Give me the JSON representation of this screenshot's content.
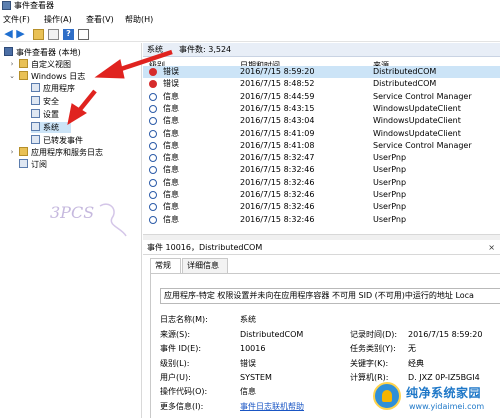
{
  "window": {
    "title": "事件查看器"
  },
  "menu": [
    "文件(F)",
    "操作(A)",
    "查看(V)",
    "帮助(H)"
  ],
  "tree": {
    "root": "事件查看器 (本地)",
    "items": [
      {
        "label": "自定义视图",
        "expander": "›"
      },
      {
        "label": "Windows 日志",
        "expander": "⌄"
      },
      {
        "label": "应用程序"
      },
      {
        "label": "安全"
      },
      {
        "label": "设置"
      },
      {
        "label": "系统"
      },
      {
        "label": "已转发事件"
      },
      {
        "label": "应用程序和服务日志",
        "expander": "›"
      },
      {
        "label": "订阅"
      }
    ]
  },
  "list": {
    "header": "系统",
    "count_text": "事件数: 3,524",
    "columns": [
      "级别",
      "日期和时间",
      "来源"
    ],
    "rows": [
      {
        "level": "错误",
        "type": "err",
        "datetime": "2016/7/15 8:59:20",
        "source": "DistributedCOM"
      },
      {
        "level": "错误",
        "type": "err",
        "datetime": "2016/7/15 8:48:52",
        "source": "DistributedCOM"
      },
      {
        "level": "信息",
        "type": "info",
        "datetime": "2016/7/15 8:44:59",
        "source": "Service Control Manager"
      },
      {
        "level": "信息",
        "type": "info",
        "datetime": "2016/7/15 8:43:15",
        "source": "WindowsUpdateClient"
      },
      {
        "level": "信息",
        "type": "info",
        "datetime": "2016/7/15 8:43:04",
        "source": "WindowsUpdateClient"
      },
      {
        "level": "信息",
        "type": "info",
        "datetime": "2016/7/15 8:41:09",
        "source": "WindowsUpdateClient"
      },
      {
        "level": "信息",
        "type": "info",
        "datetime": "2016/7/15 8:41:08",
        "source": "Service Control Manager"
      },
      {
        "level": "信息",
        "type": "info",
        "datetime": "2016/7/15 8:32:47",
        "source": "UserPnp"
      },
      {
        "level": "信息",
        "type": "info",
        "datetime": "2016/7/15 8:32:46",
        "source": "UserPnp"
      },
      {
        "level": "信息",
        "type": "info",
        "datetime": "2016/7/15 8:32:46",
        "source": "UserPnp"
      },
      {
        "level": "信息",
        "type": "info",
        "datetime": "2016/7/15 8:32:46",
        "source": "UserPnp"
      },
      {
        "level": "信息",
        "type": "info",
        "datetime": "2016/7/15 8:32:46",
        "source": "UserPnp"
      },
      {
        "level": "信息",
        "type": "info",
        "datetime": "2016/7/15 8:32:46",
        "source": "UserPnp"
      }
    ]
  },
  "detail": {
    "header": "事件 10016，DistributedCOM",
    "close": "×",
    "tabs": [
      "常规",
      "详细信息"
    ],
    "description": "应用程序-特定 权限设置并未向在应用程序容器 不可用 SID (不可用)中运行的地址 Loca",
    "fields": [
      {
        "k": "日志名称(M):",
        "v": "系统"
      },
      {
        "k": "来源(S):",
        "v": "DistributedCOM"
      },
      {
        "k": "事件 ID(E):",
        "v": "10016"
      },
      {
        "k": "级别(L):",
        "v": "错误"
      },
      {
        "k": "用户(U):",
        "v": "SYSTEM"
      },
      {
        "k": "操作代码(O):",
        "v": "信息"
      },
      {
        "k": "更多信息(I):",
        "v": "事件日志联机帮助"
      }
    ],
    "fields_right": [
      {
        "k": "记录时间(D):",
        "v": "2016/7/15 8:59:20"
      },
      {
        "k": "任务类别(Y):",
        "v": "无"
      },
      {
        "k": "关键字(K):",
        "v": "经典"
      },
      {
        "k": "计算机(R):",
        "v": "D. JXZ 0P-IZ5BGI4"
      }
    ]
  },
  "watermarks": {
    "left_text": "3PCS",
    "site_name": "纯净系统家园",
    "site_url": "www.yidaimei.com"
  },
  "colors": {
    "annotation": "#e0231f",
    "selection": "#cce4f7",
    "link": "#1a56c4"
  }
}
